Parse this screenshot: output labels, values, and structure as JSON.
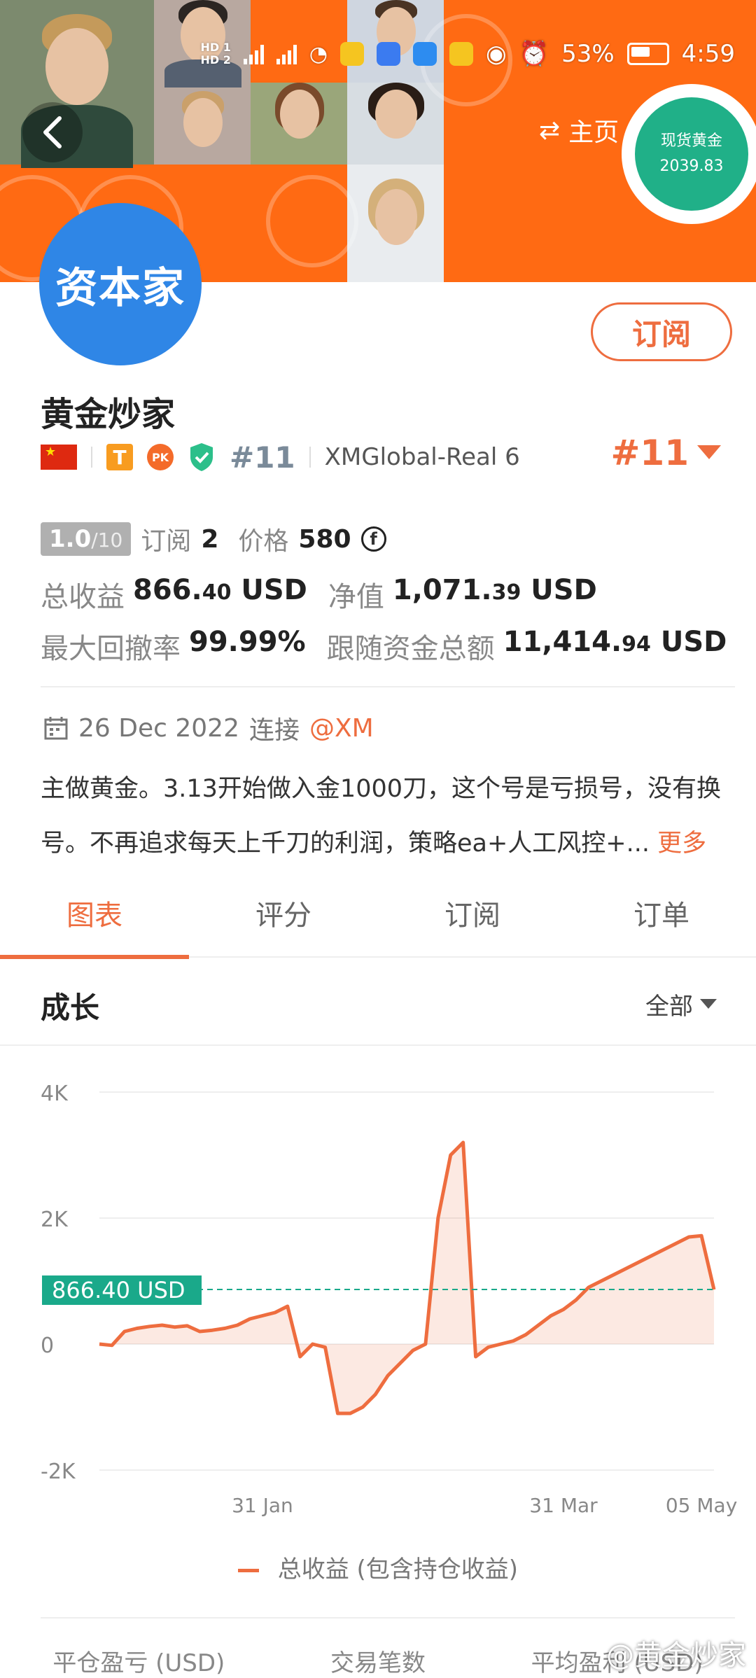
{
  "status_bar": {
    "hd1": "HD 1",
    "hd2": "HD 2",
    "net1": "4G",
    "net2": "4G",
    "battery": "53%",
    "time": "4:59"
  },
  "header": {
    "home_label": "主页",
    "gold_badge": {
      "title": "现货黄金",
      "price": "2039.83"
    }
  },
  "profile": {
    "avatar_text": "资本家",
    "subscribe_label": "订阅",
    "name": "黄金炒家",
    "tier_badge": "T",
    "pk_badge": "PK",
    "rank": "#11",
    "broker": "XMGlobal-Real 6",
    "rank_right": "#11",
    "score": "1.0",
    "score_max": "/10",
    "subscriptions_label": "订阅",
    "subscriptions_value": "2",
    "price_label": "价格",
    "price_value": "580",
    "currency_symbol": "f",
    "total_profit_label": "总收益",
    "total_profit_int": "866.",
    "total_profit_dec": "40",
    "total_profit_unit": "USD",
    "equity_label": "净值",
    "equity_int": "1,071.",
    "equity_dec": "39",
    "equity_unit": "USD",
    "max_drawdown_label": "最大回撤率",
    "max_drawdown_value": "99.99%",
    "follow_funds_label": "跟随资金总额",
    "follow_funds_int": "11,414.",
    "follow_funds_dec": "94",
    "follow_funds_unit": "USD",
    "joined_date": "26 Dec 2022",
    "joined_label": "连接",
    "joined_broker": "@XM",
    "description": "主做黄金。3.13开始做入金1000刀，这个号是亏损号，没有换号。不再追求每天上千刀的利润，策略ea+人工风控+...",
    "more_label": "更多"
  },
  "tabs": [
    {
      "label": "图表",
      "active": true
    },
    {
      "label": "评分",
      "active": false
    },
    {
      "label": "订阅",
      "active": false
    },
    {
      "label": "订单",
      "active": false
    }
  ],
  "growth": {
    "title": "成长",
    "filter_label": "全部"
  },
  "chart_data": {
    "type": "area",
    "ylim": [
      -2000,
      4000
    ],
    "yticks": [
      "4K",
      "2K",
      "0",
      "-2K"
    ],
    "xticks": [
      "31 Jan",
      "31 Mar",
      "05 May"
    ],
    "reference_label": "866.40 USD",
    "reference_value": 866.4,
    "legend": "总收益 (包含持仓收益)",
    "series": [
      {
        "name": "总收益 (包含持仓收益)",
        "x": [
          "26 Dec",
          "28 Dec",
          "30 Dec",
          "2 Jan",
          "5 Jan",
          "8 Jan",
          "11 Jan",
          "14 Jan",
          "17 Jan",
          "20 Jan",
          "23 Jan",
          "26 Jan",
          "29 Jan",
          "1 Feb",
          "4 Feb",
          "7 Feb",
          "10 Feb",
          "12 Feb",
          "14 Feb",
          "16 Feb",
          "18 Feb",
          "21 Feb",
          "24 Feb",
          "27 Feb",
          "1 Mar",
          "3 Mar",
          "5 Mar",
          "7 Mar",
          "9 Mar",
          "11 Mar",
          "13 Mar",
          "15 Mar",
          "17 Mar",
          "20 Mar",
          "23 Mar",
          "26 Mar",
          "29 Mar",
          "1 Apr",
          "4 Apr",
          "7 Apr",
          "10 Apr",
          "13 Apr",
          "16 Apr",
          "19 Apr",
          "22 Apr",
          "25 Apr",
          "28 Apr",
          "1 May",
          "4 May",
          "6 May"
        ],
        "values": [
          0,
          -20,
          200,
          250,
          280,
          300,
          270,
          290,
          200,
          220,
          250,
          300,
          400,
          450,
          500,
          600,
          -200,
          0,
          -50,
          -1100,
          -1100,
          -1000,
          -800,
          -500,
          -300,
          -100,
          0,
          2000,
          3000,
          3200,
          -200,
          -50,
          0,
          50,
          150,
          300,
          450,
          550,
          700,
          900,
          1000,
          1100,
          1200,
          1300,
          1400,
          1500,
          1600,
          1700,
          1720,
          866
        ]
      }
    ]
  },
  "bottom_stats": [
    "平仓盈亏 (USD)",
    "交易笔数",
    "平均盈利 (USD)"
  ],
  "watermark": "@黄金炒家"
}
